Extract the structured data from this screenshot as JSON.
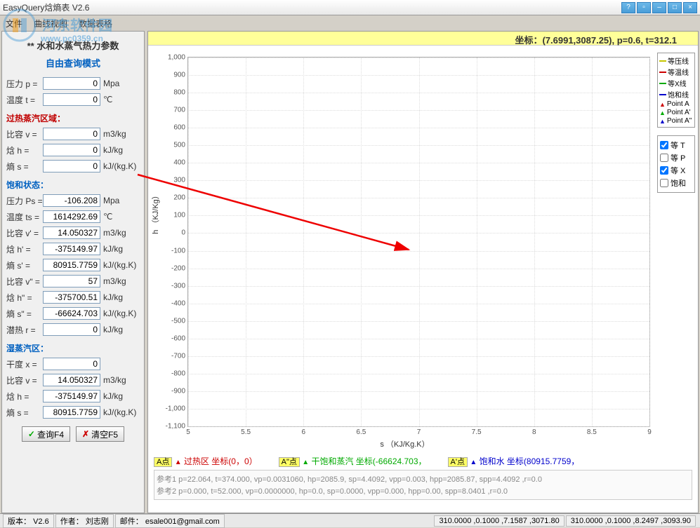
{
  "window": {
    "title": "EasyQuery焓熵表 V2.6"
  },
  "menu": {
    "file": "文件",
    "curve": "曲线视图",
    "data": "数据表格"
  },
  "watermark": {
    "cn": "河东软件园",
    "url": "www.pc0359.cn"
  },
  "panel": {
    "title": "**  水和水蒸气热力参数",
    "mode": "自由查询模式",
    "inputs": {
      "p_label": "压力 p =",
      "p_val": "0",
      "p_unit": "Mpa",
      "t_label": "温度 t =",
      "t_val": "0",
      "t_unit": "℃"
    },
    "sh_section": "过热蒸汽区域：",
    "sh": {
      "v_label": "比容 v =",
      "v_val": "0",
      "v_unit": "m3/kg",
      "h_label": "焓   h =",
      "h_val": "0",
      "h_unit": "kJ/kg",
      "s_label": "熵   s =",
      "s_val": "0",
      "s_unit": "kJ/(kg.K)"
    },
    "sat_section": "饱和状态：",
    "sat": {
      "ps_label": "压力 Ps =",
      "ps_val": "-106.208",
      "ps_unit": "Mpa",
      "ts_label": "温度 ts =",
      "ts_val": "1614292.69",
      "ts_unit": "℃",
      "vp_label": "比容 v' =",
      "vp_val": "14.050327",
      "vp_unit": "m3/kg",
      "hp_label": "焓   h' =",
      "hp_val": "-375149.97",
      "hp_unit": "kJ/kg",
      "sp_label": "熵   s' =",
      "sp_val": "80915.7759",
      "sp_unit": "kJ/(kg.K)",
      "vpp_label": "比容 v\" =",
      "vpp_val": "57",
      "vpp_unit": "m3/kg",
      "hpp_label": "焓   h\" =",
      "hpp_val": "-375700.51",
      "hpp_unit": "kJ/kg",
      "spp_label": "熵   s\" =",
      "spp_val": "-66624.703",
      "spp_unit": "kJ/(kg.K)",
      "r_label": "潜热 r =",
      "r_val": "0",
      "r_unit": "kJ/kg"
    },
    "wet_section": "湿蒸汽区：",
    "wet": {
      "x_label": "干度 x =",
      "x_val": "0",
      "x_unit": "",
      "v_label": "比容 v =",
      "v_val": "14.050327",
      "v_unit": "m3/kg",
      "h_label": "焓   h =",
      "h_val": "-375149.97",
      "h_unit": "kJ/kg",
      "s_label": "熵   s =",
      "s_val": "80915.7759",
      "s_unit": "kJ/(kg.K)"
    },
    "buttons": {
      "query": "查询F4",
      "clear": "清空F5"
    }
  },
  "coord_text": "坐标：(7.6991,3087.25), p=0.6, t=312.1",
  "chart_data": {
    "type": "line",
    "title": "",
    "xlabel": "s （KJ/Kg.K）",
    "ylabel": "h （KJ/Kg）",
    "xlim": [
      5,
      9
    ],
    "ylim": [
      -1100,
      1000
    ],
    "xticks": [
      5,
      5.5,
      6,
      6.5,
      7,
      7.5,
      8,
      8.5,
      9
    ],
    "yticks": [
      -1100,
      -1000,
      -900,
      -800,
      -700,
      -600,
      -500,
      -400,
      -300,
      -200,
      -100,
      0,
      100,
      200,
      300,
      400,
      500,
      600,
      700,
      800,
      900,
      1000
    ],
    "series": []
  },
  "legend": {
    "isobar": "等压线",
    "isotherm": "等温线",
    "isox": "等X线",
    "sat": "饱和线",
    "pa": "Point A",
    "pap": "Point A'",
    "papp": "Point A\""
  },
  "checks": {
    "t": "等 T",
    "p": "等 P",
    "x": "等 X",
    "sat": "饱和"
  },
  "points": {
    "a_lbl": "A点",
    "a_txt": "过热区 坐标(0，0）",
    "ap_lbl": "A\"点",
    "ap_txt": "干饱和蒸汽 坐标(-66624.703，",
    "app_lbl": "A'点",
    "app_txt": "饱和水 坐标(80915.7759，"
  },
  "refs": {
    "r1": "参考1 p=22.064, t=374.000, vp=0.0031060, hp=2085.9, sp=4.4092, vpp=0.003, hpp=2085.87, spp=4.4092 ,r=0.0",
    "r2": "参考2 p=0.000, t=52.000, vp=0.0000000, hp=0.0, sp=0.0000, vpp=0.000, hpp=0.00, spp=8.0401 ,r=0.0"
  },
  "status": {
    "ver_lbl": "版本：",
    "ver": "V2.6",
    "auth_lbl": "作者：",
    "auth": "刘志刚",
    "mail_lbl": "邮件：",
    "mail": "esale001@gmail.com",
    "nums": "310.0000 ,0.1000 ,7.1587 ,3071.80",
    "nums2": "310.0000 ,0.1000 ,8.2497 ,3093.90"
  }
}
